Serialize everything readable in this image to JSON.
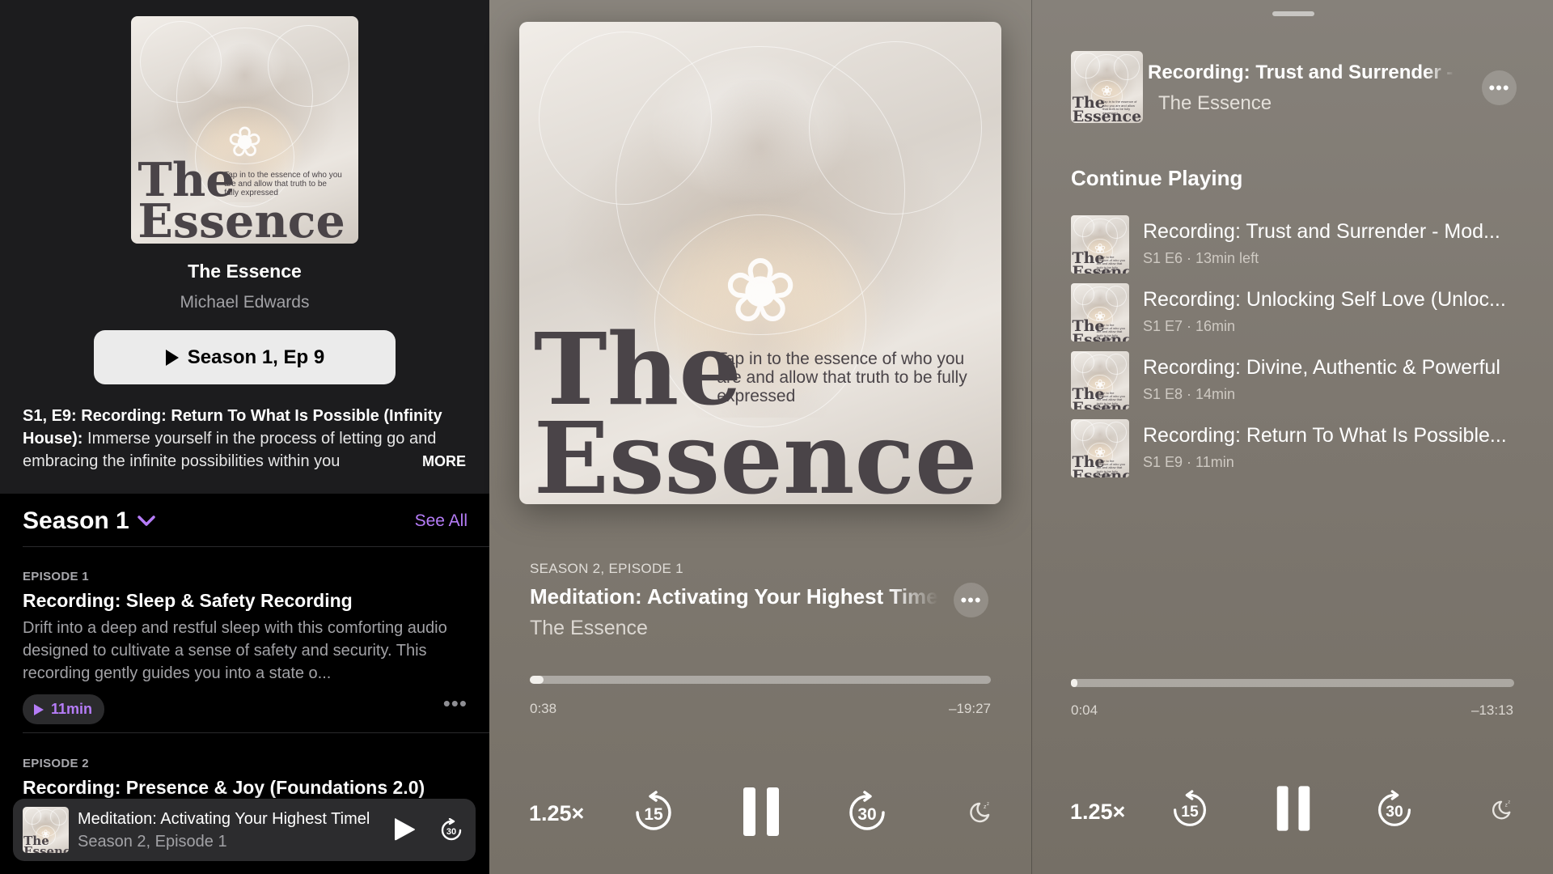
{
  "cover": {
    "title_line1": "The",
    "title_line2": "Essence",
    "tagline": "Tap in to the essence of who you are and allow that truth to be fully expressed"
  },
  "show_page": {
    "show_title": "The Essence",
    "author": "Michael Edwards",
    "play_button_label": "Season 1, Ep 9",
    "description_bold": "S1, E9: Recording: Return To What Is Possible (Infinity House):",
    "description_text": " Immerse yourself in the process of letting go and embracing the infinite possibilities within you ",
    "more_label": "MORE",
    "season_title": "Season 1",
    "see_all_label": "See All",
    "episodes": [
      {
        "number": "EPISODE 1",
        "title": "Recording: Sleep & Safety Recording",
        "summary": "Drift into a deep and restful sleep with this comforting audio designed to cultivate a sense of safety and security. This recording gently guides you into a state o...",
        "duration": "11min"
      },
      {
        "number": "EPISODE 2",
        "title": "Recording: Presence & Joy (Foundations 2.0)"
      }
    ]
  },
  "mini_player": {
    "title": "Meditation: Activating Your Highest Timeline",
    "subtitle": "Season 2, Episode 1"
  },
  "now_playing": {
    "episode_label": "SEASON 2, EPISODE 1",
    "title": "Meditation: Activating Your Highest Timeline",
    "show": "The Essence",
    "elapsed": "0:38",
    "remaining": "–19:27",
    "progress": 0.03,
    "speed": "1.25×",
    "skip_back": "15",
    "skip_forward": "30"
  },
  "queue_panel": {
    "current_title": "Recording: Trust and Surrender - Moderate",
    "current_show": "The Essence",
    "heading": "Continue Playing",
    "items": [
      {
        "title": "Recording: Trust and Surrender - Mod...",
        "meta": "S1 E6 · 13min left"
      },
      {
        "title": "Recording: Unlocking Self Love (Unloc...",
        "meta": "S1 E7 · 16min"
      },
      {
        "title": "Recording: Divine, Authentic & Powerful",
        "meta": "S1 E8 · 14min"
      },
      {
        "title": "Recording: Return To What Is Possible...",
        "meta": "S1 E9 · 11min"
      }
    ],
    "elapsed": "0:04",
    "remaining": "–13:13",
    "progress": 0.005,
    "speed": "1.25×",
    "skip_back": "15",
    "skip_forward": "30"
  },
  "colors": {
    "accent": "#b57cf7",
    "player_bg": "#807a71",
    "show_bg": "#1c1c1e"
  }
}
